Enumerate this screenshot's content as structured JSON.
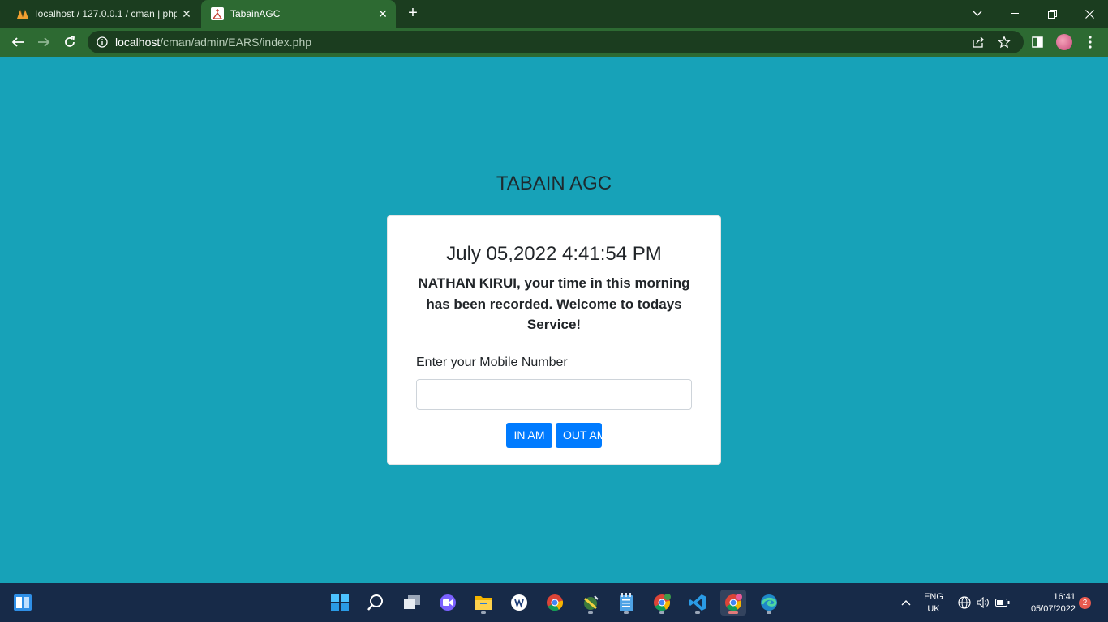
{
  "browser": {
    "tabs": [
      {
        "title": "localhost / 127.0.0.1 / cman | php",
        "close": "✕",
        "favicon": "phpmyadmin-icon"
      },
      {
        "title": "TabainAGC",
        "close": "✕",
        "favicon": "church-icon"
      }
    ],
    "new_tab": "+",
    "url_host": "localhost",
    "url_path": "/cman/admin/EARS/index.php"
  },
  "page": {
    "heading": "TABAIN AGC",
    "clock": "July 05,2022 4:41:54 PM",
    "message": "NATHAN KIRUI, your time in this morning has been recorded. Welcome to todays Service!",
    "mobile_label": "Enter your Mobile Number",
    "mobile_value": "",
    "btn_in": "IN AM",
    "btn_out": "OUT AM"
  },
  "taskbar": {
    "lang_line1": "ENG",
    "lang_line2": "UK",
    "time": "16:41",
    "date": "05/07/2022",
    "notifications": "2",
    "apps": [
      "start",
      "search",
      "task-view",
      "chat",
      "file-explorer",
      "app",
      "chrome",
      "app",
      "notepad",
      "chrome",
      "vscode",
      "chrome",
      "edge"
    ]
  },
  "colors": {
    "page_background": "#17a2b8",
    "primary_button": "#007bff",
    "browser_frame": "#1b3d1f",
    "browser_toolbar": "#2d6a32",
    "taskbar": "#172a48"
  }
}
